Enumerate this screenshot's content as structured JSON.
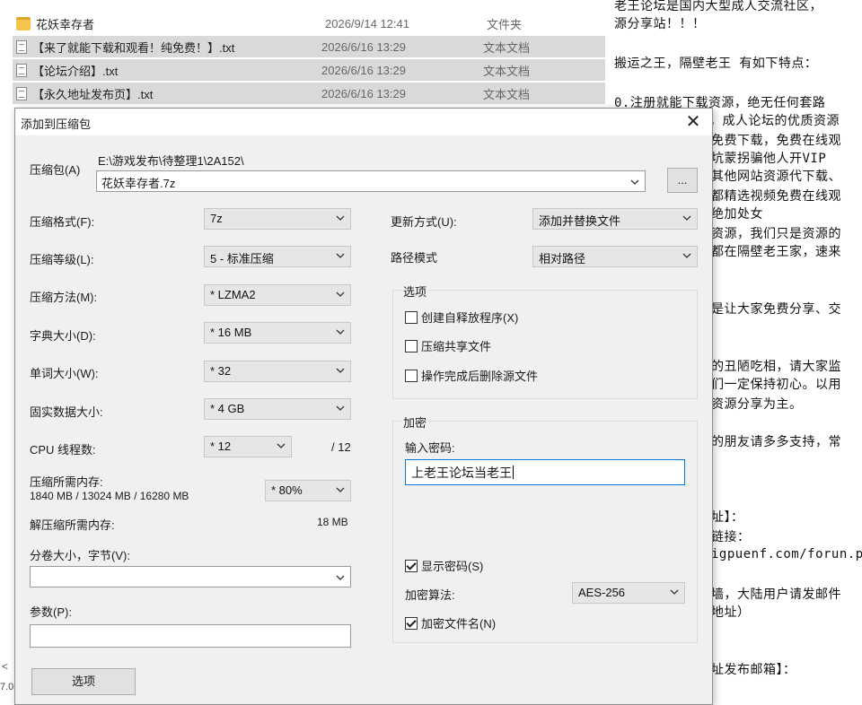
{
  "explorer": {
    "files": [
      {
        "icon": "folder-icon",
        "name": "花妖幸存者",
        "date": "2026/9/14 12:41",
        "type": "文件夹",
        "selected": false
      },
      {
        "icon": "txt-file-icon",
        "name": "【来了就能下载和观看！纯免费！】.txt",
        "date": "2026/6/16 13:29",
        "type": "文本文档",
        "selected": true
      },
      {
        "icon": "txt-file-icon",
        "name": "【论坛介绍】.txt",
        "date": "2026/6/16 13:29",
        "type": "文本文档",
        "selected": true
      },
      {
        "icon": "txt-file-icon",
        "name": "【永久地址发布页】.txt",
        "date": "2026/6/16 13:29",
        "type": "文本文档",
        "selected": true
      }
    ],
    "scroll_left": "<",
    "side_fragment": "7.0"
  },
  "notepad": {
    "lines": [
      "老王论坛是国内大型成人交流社区，",
      "源分享站！！！",
      "搬运之王，隔壁老王 有如下特点：",
      "0.注册就能下载资源，绝无任何套路",
      "，成人论坛的优质资源",
      "免费下载，免费在线观",
      "坑蒙拐骗他人开VIP",
      "其他网站资源代下载、",
      "都精选视频免费在线观",
      "绝加处女",
      "资源，我们只是资源的",
      "都在隔壁老王家，速来",
      "是让大家免费分享、交",
      "的丑陋吃相，请大家监",
      "们一定保持初心。以用",
      "资源分享为主。",
      "的朋友请多多支持，常",
      "址】：",
      "链接：",
      "igpuenf.com/forun.ph",
      "墙，大陆用户请发邮件",
      "地址）",
      "址发布邮箱】："
    ]
  },
  "dialog": {
    "title": "添加到压缩包",
    "close": "✕",
    "archive_label": "压缩包(A)",
    "archive_path": "E:\\游戏发布\\待整理1\\2A152\\",
    "archive_name": "花妖幸存者.7z",
    "browse_label": "...",
    "format_label": "压缩格式(F):",
    "format_value": "7z",
    "level_label": "压缩等级(L):",
    "level_value": "5 - 标准压缩",
    "method_label": "压缩方法(M):",
    "method_value": "* LZMA2",
    "dict_label": "字典大小(D):",
    "dict_value": "* 16 MB",
    "word_label": "单词大小(W):",
    "word_value": "* 32",
    "solid_label": "固实数据大小:",
    "solid_value": "* 4 GB",
    "cpu_label": "CPU 线程数:",
    "cpu_value": "* 12",
    "cpu_max": "/ 12",
    "mem_label": "压缩所需内存:",
    "mem_value": "1840 MB / 13024 MB / 16280 MB",
    "mem_percent": "* 80%",
    "decomp_label": "解压缩所需内存:",
    "decomp_value": "18 MB",
    "volume_label": "分卷大小，字节(V):",
    "volume_value": "",
    "params_label": "参数(P):",
    "params_value": "",
    "options_button": "选项",
    "update_label": "更新方式(U):",
    "update_value": "添加并替换文件",
    "path_label": "路径模式",
    "path_value": "相对路径",
    "options_group": "选项",
    "opt_sfx": {
      "label": "创建自释放程序(X)",
      "checked": false
    },
    "opt_shared": {
      "label": "压缩共享文件",
      "checked": false
    },
    "opt_delete": {
      "label": "操作完成后删除源文件",
      "checked": false
    },
    "encrypt_group": "加密",
    "password_label": "输入密码:",
    "password_value": "上老王论坛当老王",
    "show_password": {
      "label": "显示密码(S)",
      "checked": true
    },
    "algo_label": "加密算法:",
    "algo_value": "AES-256",
    "encrypt_names": {
      "label": "加密文件名(N)",
      "checked": true
    }
  }
}
